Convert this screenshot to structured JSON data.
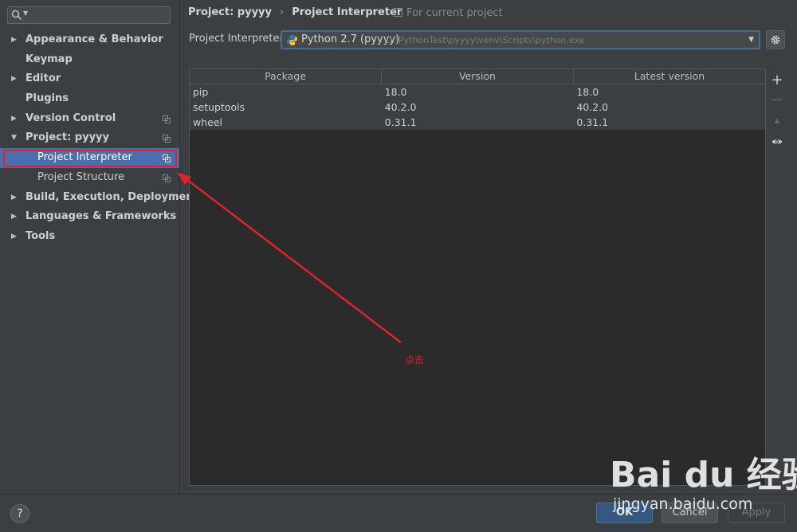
{
  "sidebar": {
    "items": [
      {
        "label": "Appearance & Behavior",
        "arrow": "▶",
        "child": false,
        "copy": false
      },
      {
        "label": "Keymap",
        "arrow": "",
        "child": false,
        "copy": false
      },
      {
        "label": "Editor",
        "arrow": "▶",
        "child": false,
        "copy": false
      },
      {
        "label": "Plugins",
        "arrow": "",
        "child": false,
        "copy": false
      },
      {
        "label": "Version Control",
        "arrow": "▶",
        "child": false,
        "copy": true
      },
      {
        "label": "Project: pyyyy",
        "arrow": "▼",
        "child": false,
        "copy": true
      },
      {
        "label": "Project Interpreter",
        "arrow": "",
        "child": true,
        "copy": true,
        "selected": true
      },
      {
        "label": "Project Structure",
        "arrow": "",
        "child": true,
        "copy": true
      },
      {
        "label": "Build, Execution, Deployment",
        "arrow": "▶",
        "child": false,
        "copy": false
      },
      {
        "label": "Languages & Frameworks",
        "arrow": "▶",
        "child": false,
        "copy": false
      },
      {
        "label": "Tools",
        "arrow": "▶",
        "child": false,
        "copy": false
      }
    ]
  },
  "breadcrumb": {
    "project": "Project: pyyyy",
    "separator": "›",
    "page": "Project Interpreter",
    "scope": "For current project"
  },
  "interpreter": {
    "label": "Project Interpreter:",
    "name": "Python 2.7 (pyyyy)",
    "path": "D:\\PythonTest\\pyyyy\\venv\\Scripts\\python.exe"
  },
  "table": {
    "headers": [
      "Package",
      "Version",
      "Latest version"
    ],
    "rows": [
      [
        "pip",
        "18.0",
        "18.0"
      ],
      [
        "setuptools",
        "40.2.0",
        "40.2.0"
      ],
      [
        "wheel",
        "0.31.1",
        "0.31.1"
      ]
    ]
  },
  "tools": {
    "add": "+",
    "remove": "−",
    "upgrade": "▲"
  },
  "footer": {
    "help": "?",
    "ok": "OK",
    "cancel": "Cancel",
    "apply": "Apply"
  },
  "annotation": {
    "text": "点击",
    "color": "#e0222c"
  },
  "watermark": {
    "brand": "Bai du 经验",
    "site": "jingyan.baidu.com"
  },
  "colors": {
    "selection": "#4b6eaf",
    "accent_border": "#466d94",
    "ok_button": "#365880"
  }
}
